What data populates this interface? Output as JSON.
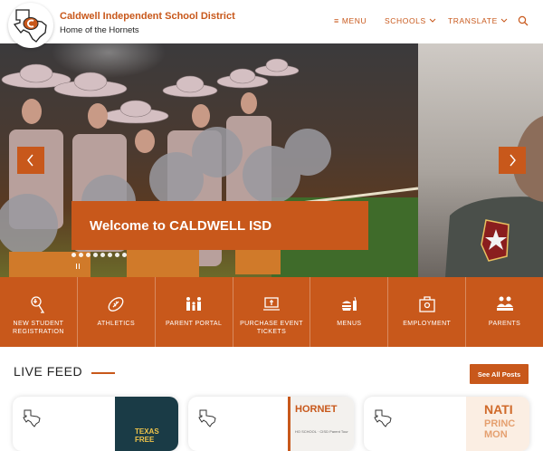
{
  "header": {
    "title": "Caldwell Independent School District",
    "subtitle": "Home of the Hornets",
    "nav": {
      "menu": "MENU",
      "schools": "SCHOOLS",
      "translate": "TRANSLATE"
    },
    "logo_icon": "texas-c-logo-icon",
    "search_icon": "search-icon"
  },
  "hero": {
    "welcome": "Welcome to CALDWELL ISD",
    "dot_count": 8
  },
  "quick_links": [
    {
      "label": "NEW STUDENT REGISTRATION",
      "icon": "registration-icon"
    },
    {
      "label": "ATHLETICS",
      "icon": "football-icon"
    },
    {
      "label": "PARENT PORTAL",
      "icon": "family-icon"
    },
    {
      "label": "PURCHASE EVENT TICKETS",
      "icon": "laptop-icon"
    },
    {
      "label": "MENUS",
      "icon": "food-icon"
    },
    {
      "label": "EMPLOYMENT",
      "icon": "briefcase-icon"
    },
    {
      "label": "PARENTS",
      "icon": "parents-icon"
    }
  ],
  "feed": {
    "title": "LIVE FEED",
    "all_posts": "See All Posts",
    "cards": [
      {
        "image_text": "TEXAS FREE"
      },
      {
        "image_text": "HORNET",
        "image_subtext": "HO SCHOOL · CISD Parent Tour"
      },
      {
        "image_text": "NATI",
        "image_subtext": "PRINC MON"
      }
    ]
  },
  "colors": {
    "accent": "#c8581b",
    "text": "#222222"
  }
}
